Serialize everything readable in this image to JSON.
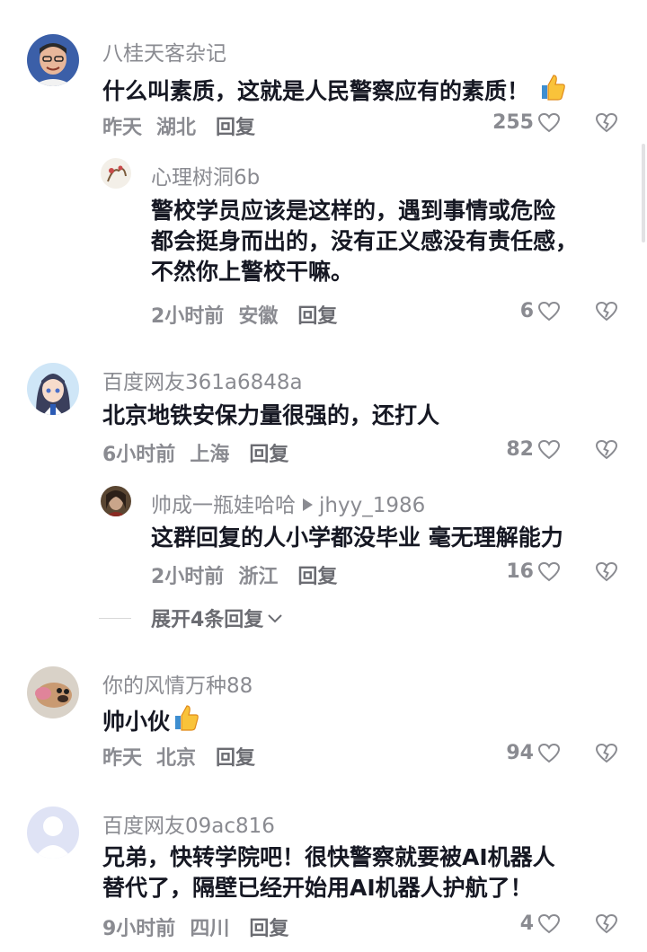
{
  "comments": [
    {
      "user": "八桂天客杂记",
      "text_lines": [
        "什么叫素质，这就是人民警察应有的素质！"
      ],
      "emoji": "thumbs-up",
      "time": "昨天",
      "location": "湖北",
      "reply": "回复",
      "likes": "255",
      "replies": [
        {
          "user": "心理树洞6b",
          "text_lines": [
            "警校学员应该是这样的，遇到事情或危险",
            "都会挺身而出的，没有正义感没有责任感，",
            "不然你上警校干嘛。"
          ],
          "time": "2小时前",
          "location": "安徽",
          "reply": "回复",
          "likes": "6"
        }
      ]
    },
    {
      "user": "百度网友361a6848a",
      "text_lines": [
        "北京地铁安保力量很强的，还打人"
      ],
      "time": "6小时前",
      "location": "上海",
      "reply": "回复",
      "likes": "82",
      "replies": [
        {
          "user": "帅成一瓶娃哈哈",
          "reply_to": "jhyy_1986",
          "text_lines": [
            "这群回复的人小学都没毕业 毫无理解能力"
          ],
          "time": "2小时前",
          "location": "浙江",
          "reply": "回复",
          "likes": "16"
        }
      ],
      "expand_label": "展开4条回复"
    },
    {
      "user": "你的风情万种88",
      "text_lines": [
        "帅小伙"
      ],
      "emoji": "thumbs-up",
      "time": "昨天",
      "location": "北京",
      "reply": "回复",
      "likes": "94"
    },
    {
      "user": "百度网友09ac816",
      "text_lines": [
        "兄弟，快转学院吧！很快警察就要被AI机器人",
        "替代了，隔壁已经开始用AI机器人护航了！"
      ],
      "time": "9小时前",
      "location": "四川",
      "reply": "回复",
      "likes": "4"
    }
  ],
  "colors": {
    "text": "#161823",
    "secondary": "#8a8b91",
    "thumb": "#f5a623"
  },
  "icons": [
    "heart-outline-icon",
    "broken-heart-icon",
    "thumbs-up-icon",
    "chevron-down-icon",
    "reply-arrow-icon"
  ]
}
